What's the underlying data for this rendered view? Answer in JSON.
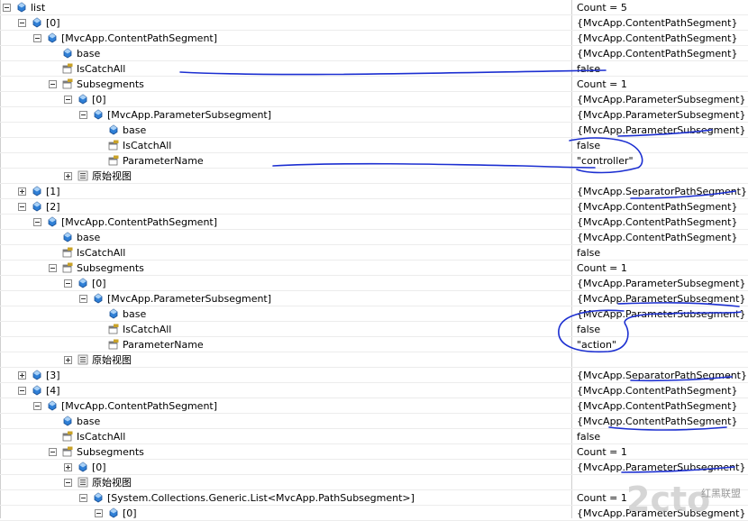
{
  "rows": [
    {
      "label": "list",
      "value": "Count = 5",
      "depth": 0,
      "expander": "minus",
      "icon": "object-icon"
    },
    {
      "label": "[0]",
      "value": "{MvcApp.ContentPathSegment}",
      "depth": 1,
      "expander": "minus",
      "icon": "object-icon"
    },
    {
      "label": "[MvcApp.ContentPathSegment]",
      "value": "{MvcApp.ContentPathSegment}",
      "depth": 2,
      "expander": "minus",
      "icon": "object-icon"
    },
    {
      "label": "base",
      "value": "{MvcApp.ContentPathSegment}",
      "depth": 3,
      "expander": "none",
      "icon": "object-icon"
    },
    {
      "label": "IsCatchAll",
      "value": "false",
      "depth": 3,
      "expander": "none",
      "icon": "property-icon"
    },
    {
      "label": "Subsegments",
      "value": "Count = 1",
      "depth": 3,
      "expander": "minus",
      "icon": "property-icon"
    },
    {
      "label": "[0]",
      "value": "{MvcApp.ParameterSubsegment}",
      "depth": 4,
      "expander": "minus",
      "icon": "object-icon"
    },
    {
      "label": "[MvcApp.ParameterSubsegment]",
      "value": "{MvcApp.ParameterSubsegment}",
      "depth": 5,
      "expander": "minus",
      "icon": "object-icon"
    },
    {
      "label": "base",
      "value": "{MvcApp.ParameterSubsegment}",
      "depth": 6,
      "expander": "none",
      "icon": "object-icon"
    },
    {
      "label": "IsCatchAll",
      "value": "false",
      "depth": 6,
      "expander": "none",
      "icon": "property-icon"
    },
    {
      "label": "ParameterName",
      "value": "\"controller\"",
      "depth": 6,
      "expander": "none",
      "icon": "property-icon"
    },
    {
      "label": "原始视图",
      "value": "",
      "depth": 4,
      "expander": "plus",
      "icon": "raw-view-icon"
    },
    {
      "label": "[1]",
      "value": "{MvcApp.SeparatorPathSegment}",
      "depth": 1,
      "expander": "plus",
      "icon": "object-icon"
    },
    {
      "label": "[2]",
      "value": "{MvcApp.ContentPathSegment}",
      "depth": 1,
      "expander": "minus",
      "icon": "object-icon"
    },
    {
      "label": "[MvcApp.ContentPathSegment]",
      "value": "{MvcApp.ContentPathSegment}",
      "depth": 2,
      "expander": "minus",
      "icon": "object-icon"
    },
    {
      "label": "base",
      "value": "{MvcApp.ContentPathSegment}",
      "depth": 3,
      "expander": "none",
      "icon": "object-icon"
    },
    {
      "label": "IsCatchAll",
      "value": "false",
      "depth": 3,
      "expander": "none",
      "icon": "property-icon"
    },
    {
      "label": "Subsegments",
      "value": "Count = 1",
      "depth": 3,
      "expander": "minus",
      "icon": "property-icon"
    },
    {
      "label": "[0]",
      "value": "{MvcApp.ParameterSubsegment}",
      "depth": 4,
      "expander": "minus",
      "icon": "object-icon"
    },
    {
      "label": "[MvcApp.ParameterSubsegment]",
      "value": "{MvcApp.ParameterSubsegment}",
      "depth": 5,
      "expander": "minus",
      "icon": "object-icon"
    },
    {
      "label": "base",
      "value": "{MvcApp.ParameterSubsegment}",
      "depth": 6,
      "expander": "none",
      "icon": "object-icon"
    },
    {
      "label": "IsCatchAll",
      "value": "false",
      "depth": 6,
      "expander": "none",
      "icon": "property-icon"
    },
    {
      "label": "ParameterName",
      "value": "\"action\"",
      "depth": 6,
      "expander": "none",
      "icon": "property-icon"
    },
    {
      "label": "原始视图",
      "value": "",
      "depth": 4,
      "expander": "plus",
      "icon": "raw-view-icon"
    },
    {
      "label": "[3]",
      "value": "{MvcApp.SeparatorPathSegment}",
      "depth": 1,
      "expander": "plus",
      "icon": "object-icon"
    },
    {
      "label": "[4]",
      "value": "{MvcApp.ContentPathSegment}",
      "depth": 1,
      "expander": "minus",
      "icon": "object-icon"
    },
    {
      "label": "[MvcApp.ContentPathSegment]",
      "value": "{MvcApp.ContentPathSegment}",
      "depth": 2,
      "expander": "minus",
      "icon": "object-icon"
    },
    {
      "label": "base",
      "value": "{MvcApp.ContentPathSegment}",
      "depth": 3,
      "expander": "none",
      "icon": "object-icon"
    },
    {
      "label": "IsCatchAll",
      "value": "false",
      "depth": 3,
      "expander": "none",
      "icon": "property-icon"
    },
    {
      "label": "Subsegments",
      "value": "Count = 1",
      "depth": 3,
      "expander": "minus",
      "icon": "property-icon"
    },
    {
      "label": "[0]",
      "value": "{MvcApp.ParameterSubsegment}",
      "depth": 4,
      "expander": "plus",
      "icon": "object-icon"
    },
    {
      "label": "原始视图",
      "value": "",
      "depth": 4,
      "expander": "minus",
      "icon": "raw-view-icon"
    },
    {
      "label": "[System.Collections.Generic.List<MvcApp.PathSubsegment>]",
      "value": "Count = 1",
      "depth": 5,
      "expander": "minus",
      "icon": "object-icon"
    },
    {
      "label": "[0]",
      "value": "{MvcApp.ParameterSubsegment}",
      "depth": 6,
      "expander": "minus",
      "icon": "object-icon"
    }
  ],
  "watermark": {
    "logo_text": "2cto",
    "caption": "红黑联盟"
  },
  "colors": {
    "ink": "#1c2fd1",
    "object_icon": "#2f7fd6",
    "property_icon": "#c9a227",
    "grid_line": "#ececec",
    "divider": "#cfcfcf"
  }
}
